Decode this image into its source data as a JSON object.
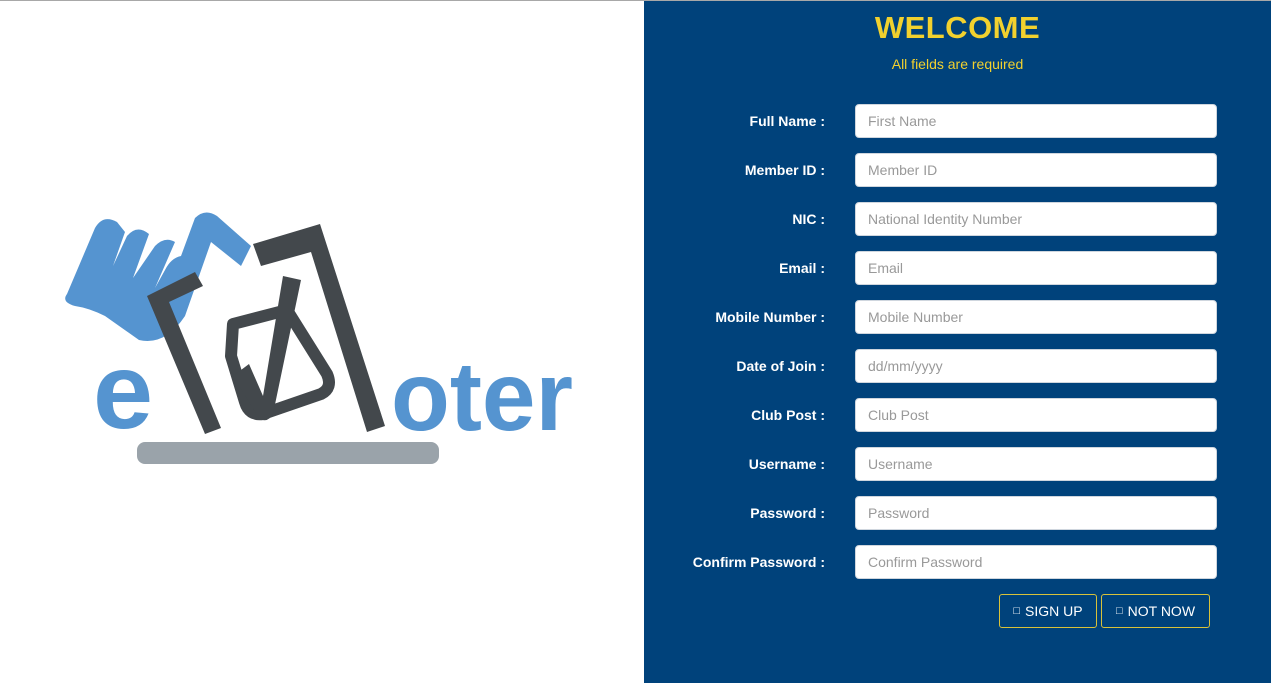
{
  "logo": {
    "name": "eVoter",
    "text_e": "e",
    "text_oter": "oter",
    "colors": {
      "blue": "#5594d0",
      "dark": "#43484c",
      "gray": "#9aa3aa"
    }
  },
  "form": {
    "title": "WELCOME",
    "subtitle": "All fields are required",
    "fields": [
      {
        "label": "Full Name :",
        "placeholder": "First Name",
        "type": "text"
      },
      {
        "label": "Member ID :",
        "placeholder": "Member ID",
        "type": "text"
      },
      {
        "label": "NIC :",
        "placeholder": "National Identity Number",
        "type": "text"
      },
      {
        "label": "Email :",
        "placeholder": "Email",
        "type": "email"
      },
      {
        "label": "Mobile Number :",
        "placeholder": "Mobile Number",
        "type": "text"
      },
      {
        "label": "Date of Join :",
        "placeholder": "dd/mm/yyyy",
        "type": "date"
      },
      {
        "label": "Club Post :",
        "placeholder": "Club Post",
        "type": "text"
      },
      {
        "label": "Username :",
        "placeholder": "Username",
        "type": "text"
      },
      {
        "label": "Password :",
        "placeholder": "Password",
        "type": "password"
      },
      {
        "label": "Confirm Password :",
        "placeholder": "Confirm Password",
        "type": "password"
      }
    ],
    "buttons": {
      "signup": {
        "label": "SIGN UP",
        "icon": "user-plus-icon",
        "glyph": "□"
      },
      "notnow": {
        "label": "NOT NOW",
        "icon": "close-icon",
        "glyph": "□"
      }
    },
    "colors": {
      "panel_bg": "#00427b",
      "accent": "#f2d12e"
    }
  }
}
